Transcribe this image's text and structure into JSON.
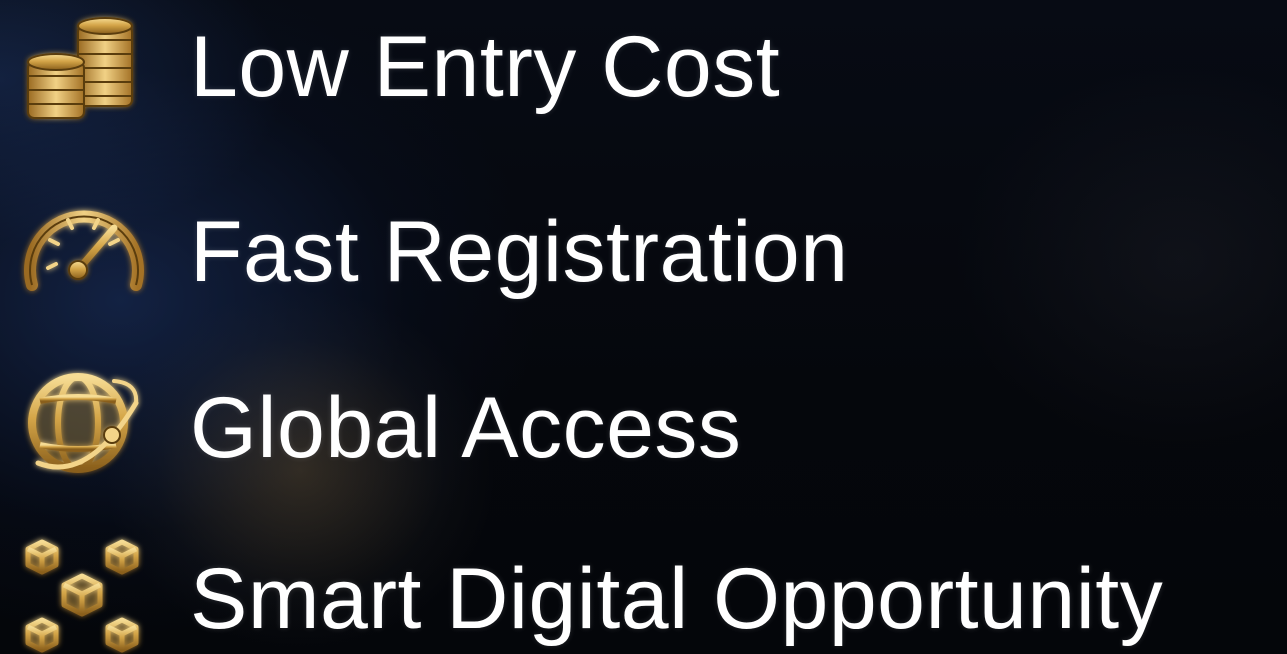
{
  "features": [
    {
      "label": "Low Entry Cost",
      "icon": "coins-stack-icon"
    },
    {
      "label": "Fast Registration",
      "icon": "speedometer-icon"
    },
    {
      "label": "Global Access",
      "icon": "globe-network-icon"
    },
    {
      "label": "Smart Digital Opportunity",
      "icon": "blockchain-cubes-icon"
    }
  ],
  "colors": {
    "text": "#ffffff",
    "gold": "#d4a548",
    "gold_light": "#f3d489",
    "background": "#05070c",
    "glow_blue": "#1e3770"
  }
}
